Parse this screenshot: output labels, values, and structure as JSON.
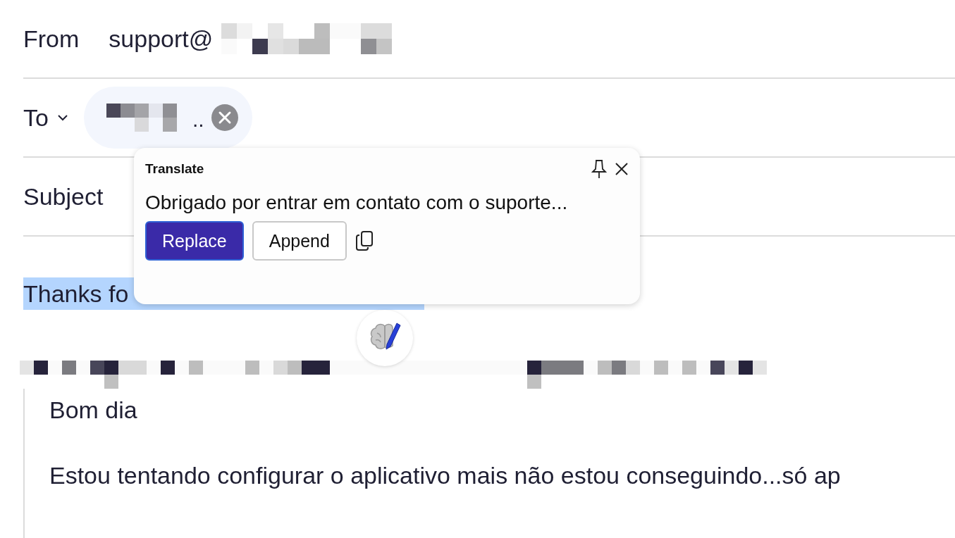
{
  "from": {
    "label": "From",
    "value": "support@"
  },
  "to": {
    "label": "To",
    "recipient_suffix": ".."
  },
  "subject": {
    "label": "Subject"
  },
  "body": {
    "selected_text": "Thanks fo",
    "quote": [
      "Bom dia",
      "Estou tentando configurar o aplicativo mais não estou conseguindo...só ap"
    ]
  },
  "translate_popup": {
    "title": "Translate",
    "text": "Obrigado por entrar em contato com o suporte...",
    "buttons": [
      {
        "label": "Replace",
        "kind": "primary"
      },
      {
        "label": "Append",
        "kind": "secondary"
      }
    ]
  }
}
